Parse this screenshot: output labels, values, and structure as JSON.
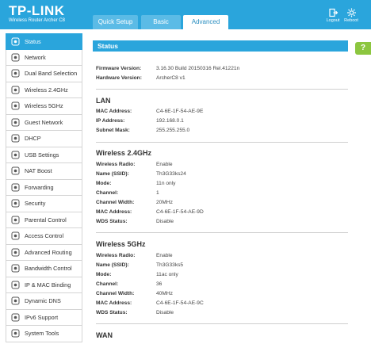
{
  "header": {
    "brand": "TP-LINK",
    "model": "Wireless Router Archer C8",
    "tabs": [
      "Quick Setup",
      "Basic",
      "Advanced"
    ],
    "logout_label": "Logout",
    "reboot_label": "Reboot",
    "colors": {
      "header": "#2aa5dc",
      "tab_inactive": "#5bbbe6"
    }
  },
  "sidebar": {
    "items": [
      {
        "label": "Status",
        "icon": "status-icon"
      },
      {
        "label": "Network",
        "icon": "globe-icon"
      },
      {
        "label": "Dual Band Selection",
        "icon": "dual-band-icon"
      },
      {
        "label": "Wireless 2.4GHz",
        "icon": "wifi-icon"
      },
      {
        "label": "Wireless 5GHz",
        "icon": "wifi-icon"
      },
      {
        "label": "Guest Network",
        "icon": "guest-icon"
      },
      {
        "label": "DHCP",
        "icon": "dhcp-icon"
      },
      {
        "label": "USB Settings",
        "icon": "usb-icon"
      },
      {
        "label": "NAT Boost",
        "icon": "nat-boost-icon"
      },
      {
        "label": "Forwarding",
        "icon": "forwarding-icon"
      },
      {
        "label": "Security",
        "icon": "lock-icon"
      },
      {
        "label": "Parental Control",
        "icon": "parental-icon"
      },
      {
        "label": "Access Control",
        "icon": "access-control-icon"
      },
      {
        "label": "Advanced Routing",
        "icon": "routing-icon"
      },
      {
        "label": "Bandwidth Control",
        "icon": "bandwidth-icon"
      },
      {
        "label": "IP & MAC Binding",
        "icon": "binding-icon"
      },
      {
        "label": "Dynamic DNS",
        "icon": "dns-icon"
      },
      {
        "label": "IPv6 Support",
        "icon": "ipv6-icon"
      },
      {
        "label": "System Tools",
        "icon": "tools-icon"
      }
    ]
  },
  "main": {
    "title": "Status",
    "help": "?",
    "firmware": {
      "rows": [
        {
          "label": "Firmware Version:",
          "value": "3.16.30 Build 20150316 Rel.41221n"
        },
        {
          "label": "Hardware Version:",
          "value": "ArcherC8 v1"
        }
      ]
    },
    "lan": {
      "title": "LAN",
      "rows": [
        {
          "label": "MAC Address:",
          "value": "C4-6E-1F-54-AE-9E"
        },
        {
          "label": "IP Address:",
          "value": "192.168.0.1"
        },
        {
          "label": "Subnet Mask:",
          "value": "255.255.255.0"
        }
      ]
    },
    "wireless24": {
      "title": "Wireless 2.4GHz",
      "rows": [
        {
          "label": "Wireless Radio:",
          "value": "Enable"
        },
        {
          "label": "Name (SSID):",
          "value": "Th3G33ks24"
        },
        {
          "label": "Mode:",
          "value": "11n only"
        },
        {
          "label": "Channel:",
          "value": "1"
        },
        {
          "label": "Channel Width:",
          "value": "20MHz"
        },
        {
          "label": "MAC Address:",
          "value": "C4-6E-1F-54-AE-9D"
        },
        {
          "label": "WDS Status:",
          "value": "Disable"
        }
      ]
    },
    "wireless5": {
      "title": "Wireless 5GHz",
      "rows": [
        {
          "label": "Wireless Radio:",
          "value": "Enable"
        },
        {
          "label": "Name (SSID):",
          "value": "Th3G33ks5"
        },
        {
          "label": "Mode:",
          "value": "11ac only"
        },
        {
          "label": "Channel:",
          "value": "36"
        },
        {
          "label": "Channel Width:",
          "value": "40MHz"
        },
        {
          "label": "MAC Address:",
          "value": "C4-6E-1F-54-AE-9C"
        },
        {
          "label": "WDS Status:",
          "value": "Disable"
        }
      ]
    },
    "wan": {
      "title": "WAN"
    }
  }
}
